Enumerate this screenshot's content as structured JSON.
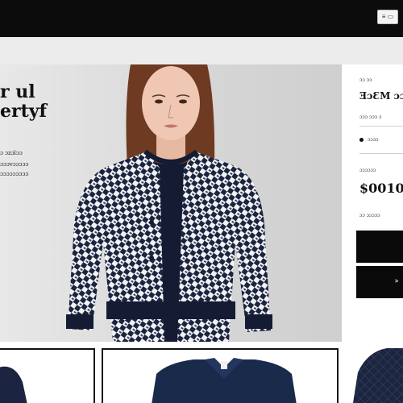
{
  "header": {
    "top_button_label": "≡ ▭"
  },
  "hero": {
    "title": "r ul\nertyf",
    "lines": [
      "ɔ ɔzɔlɔɔ",
      "ɔɔɔvɔɔɔɔɔ",
      "ɔɔɔɔɔɔɔɔɔ"
    ]
  },
  "product": {
    "eyebrow": "ɔɔ ɔɔ",
    "title": "ƎɔƐM ɔɔ",
    "subtitle": "ɔɔɔ ɔɔɔ ɔ",
    "swatch_label": "ɔɔɔɔ",
    "price_caption": "ɔɔɔɔɔɔ",
    "price": "$0010",
    "price_note": "ɔɔ ɔɔɔɔɔ",
    "button_primary": "",
    "button_secondary": ">"
  },
  "colors": {
    "topbar": "#0c0c0c",
    "hero_bg": "#d6d6d6",
    "jacket_navy": "#1b2440",
    "button_bg": "#0a0a0a"
  }
}
